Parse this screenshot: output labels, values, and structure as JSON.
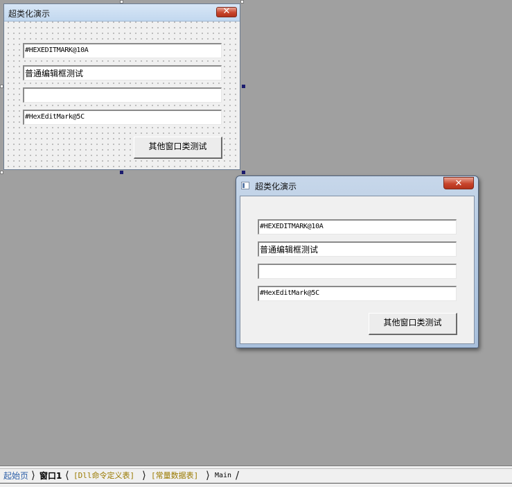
{
  "design_form": {
    "title": "超类化演示",
    "close_label": "✕",
    "hexedit1": "#HEXEDITMARK@10A",
    "normal_edit": "普通编辑框测试",
    "empty_edit": "",
    "hexedit2": "#HexEditMark@5C",
    "button_label": "其他窗口类测试"
  },
  "runtime_window": {
    "title": "超类化演示",
    "close_label": "✕",
    "hexedit1": "#HEXEDITMARK@10A",
    "normal_edit": "普通编辑框测试",
    "empty_edit": "",
    "hexedit2": "#HexEditMark@5C",
    "button_label": "其他窗口类测试"
  },
  "tabs": [
    {
      "label": "起始页"
    },
    {
      "label": "窗口1"
    },
    {
      "label": "[Dll命令定义表]"
    },
    {
      "label": "[常量数据表]"
    },
    {
      "label": "Main"
    }
  ],
  "colors": {
    "workspace": "#a0a0a0",
    "form_bg": "#f0f0f0",
    "close_red": "#c8452c",
    "tab_active": "#000000",
    "tab_link": "#2c5fa8",
    "tab_table": "#9a7a00"
  }
}
